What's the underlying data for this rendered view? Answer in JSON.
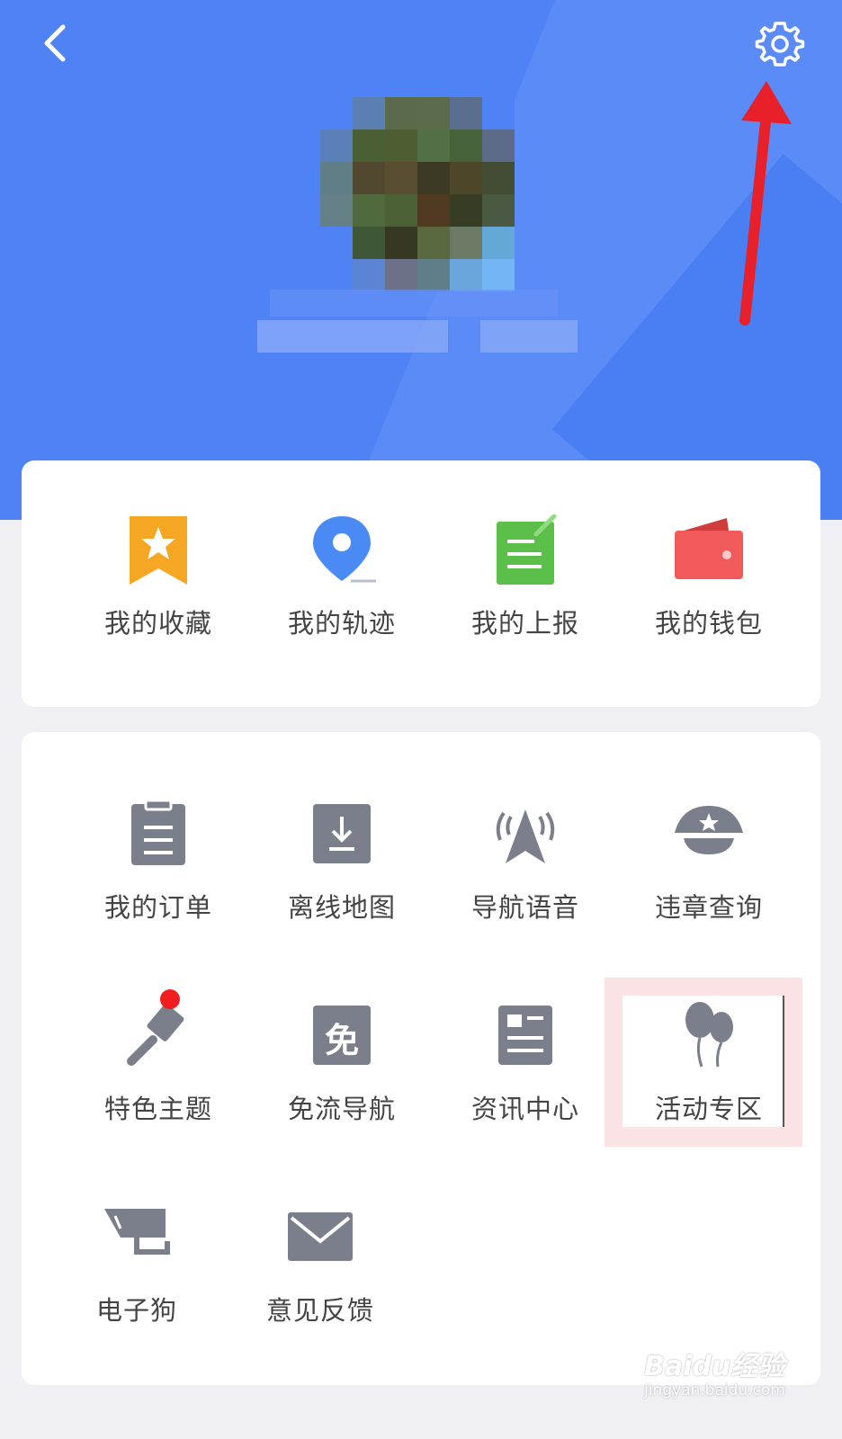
{
  "header": {
    "back_icon": "chevron-left-icon",
    "settings_icon": "gear-icon",
    "background_color": "#4e82f5",
    "annotation_arrow_color": "#e8202a"
  },
  "quick_actions": [
    {
      "label": "我的收藏",
      "icon": "bookmark-star-icon",
      "color": "#f5a623"
    },
    {
      "label": "我的轨迹",
      "icon": "location-pin-icon",
      "color": "#4a8af4"
    },
    {
      "label": "我的上报",
      "icon": "report-note-icon",
      "color": "#5cbf4a"
    },
    {
      "label": "我的钱包",
      "icon": "wallet-icon",
      "color": "#f05a5a"
    }
  ],
  "tools": [
    {
      "label": "我的订单",
      "icon": "clipboard-order-icon"
    },
    {
      "label": "离线地图",
      "icon": "download-map-icon"
    },
    {
      "label": "导航语音",
      "icon": "navigation-voice-icon"
    },
    {
      "label": "违章查询",
      "icon": "police-cap-icon"
    },
    {
      "label": "特色主题",
      "icon": "paint-brush-icon",
      "badge": true
    },
    {
      "label": "免流导航",
      "icon": "free-data-icon",
      "glyph": "免"
    },
    {
      "label": "资讯中心",
      "icon": "news-icon"
    },
    {
      "label": "活动专区",
      "icon": "balloons-icon",
      "highlighted": true
    },
    {
      "label": "电子狗",
      "icon": "speed-camera-icon"
    },
    {
      "label": "意见反馈",
      "icon": "envelope-feedback-icon"
    }
  ],
  "icon_gray": "#7b7f8c",
  "badge_color": "#f01e1e",
  "watermark": {
    "logo": "Baidu经验",
    "url": "jingyan.baidu.com"
  }
}
